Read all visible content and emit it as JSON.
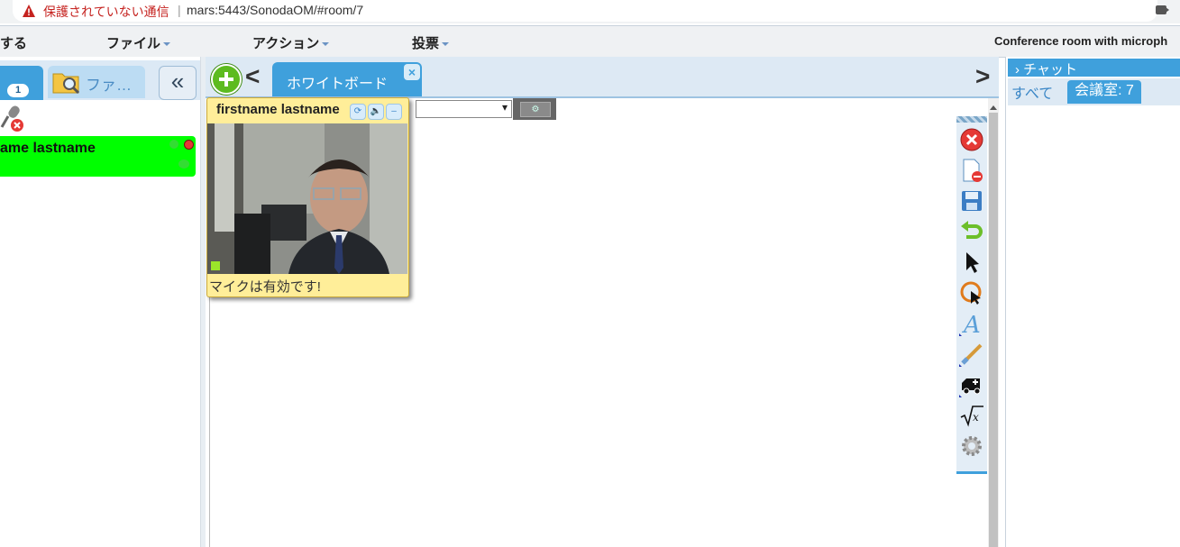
{
  "address_bar": {
    "security_warning": "保護されていない通信",
    "separator": "|",
    "url": "mars:5443/SonodaOM/#room/7"
  },
  "menubar": {
    "cut_left_label": "する",
    "file_label": "ファイル",
    "action_label": "アクション",
    "vote_label": "投票",
    "room_title": "Conference room with microph"
  },
  "left_panel": {
    "users_count": "1",
    "files_tab_label": "ファ…",
    "collapse_label": "«",
    "user_name": "ame lastname"
  },
  "whiteboard": {
    "tab_label": "ホワイトボード",
    "close_label": "×",
    "prev_label": "<",
    "next_label": ">",
    "gear_label": "⚙",
    "tools": [
      "close-icon",
      "remove-page-icon",
      "save-icon",
      "undo-icon",
      "pointer-icon",
      "pointer-circle-icon",
      "text-icon",
      "brush-icon",
      "shape-icon",
      "formula-icon",
      "settings-icon"
    ]
  },
  "video": {
    "name": "firstname lastname",
    "status": "マイクは有効です!",
    "buttons": [
      "⟳",
      "🔈",
      "–"
    ]
  },
  "chat": {
    "header": "› チャット",
    "tab_all": "すべて",
    "tab_room": "会議室: 7"
  },
  "colors": {
    "accent": "#3fa0dc",
    "user_highlight": "#00ff00",
    "video_bg": "#ffee99",
    "add_green": "#5dbb1f"
  }
}
